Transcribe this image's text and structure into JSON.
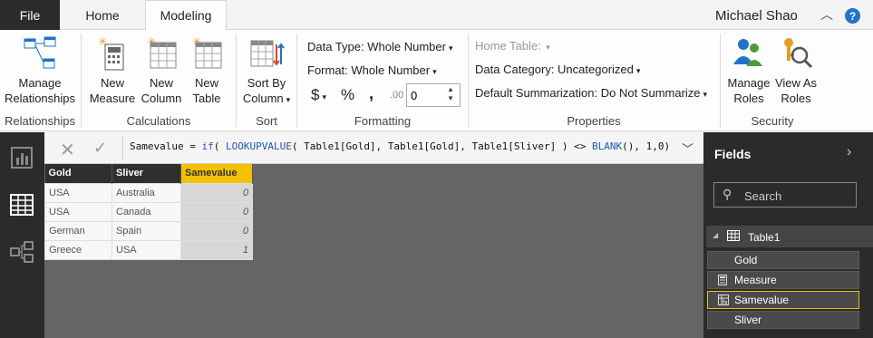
{
  "tabs": {
    "file": "File",
    "home": "Home",
    "modeling": "Modeling"
  },
  "user": {
    "name": "Michael Shao",
    "help": "?"
  },
  "ribbon": {
    "manage_relationships": [
      "Manage",
      "Relationships"
    ],
    "new_measure": [
      "New",
      "Measure"
    ],
    "new_column": [
      "New",
      "Column"
    ],
    "new_table": [
      "New",
      "Table"
    ],
    "sort_by_column": [
      "Sort By",
      "Column"
    ],
    "data_type": "Data Type: Whole Number",
    "format": "Format: Whole Number",
    "currency_symbol": "$",
    "percent_symbol": "%",
    "comma_symbol": ",",
    "decimal_symbol": ".00",
    "decimal_value": "0",
    "home_table": "Home Table:",
    "data_category": "Data Category: Uncategorized",
    "default_summarization": "Default Summarization: Do Not Summarize",
    "manage_roles": [
      "Manage",
      "Roles"
    ],
    "view_as_roles": [
      "View As",
      "Roles"
    ],
    "groups": {
      "relationships": "Relationships",
      "calculations": "Calculations",
      "sort": "Sort",
      "formatting": "Formatting",
      "properties": "Properties",
      "security": "Security"
    }
  },
  "formula": {
    "prefix": "Samevalue = ",
    "fn1": "if",
    "p1": "( ",
    "fn2": "LOOKUPVALUE",
    "args": "( Table1[Gold], Table1[Gold], Table1[Sliver] ) <> ",
    "fn3": "BLANK",
    "tail": "(), 1,0)"
  },
  "table": {
    "headers": [
      "Gold",
      "Sliver",
      "Samevalue"
    ],
    "rows": [
      [
        "USA",
        "Australia",
        "0"
      ],
      [
        "USA",
        "Canada",
        "0"
      ],
      [
        "German",
        "Spain",
        "0"
      ],
      [
        "Greece",
        "USA",
        "1"
      ]
    ]
  },
  "fields_pane": {
    "title": "Fields",
    "search_placeholder": "Search",
    "table_name": "Table1",
    "fields": [
      "Gold",
      "Measure",
      "Samevalue",
      "Sliver"
    ]
  },
  "colors": {
    "accent": "#f2c100",
    "dark": "#2b2b2b",
    "help": "#1f73c9"
  }
}
